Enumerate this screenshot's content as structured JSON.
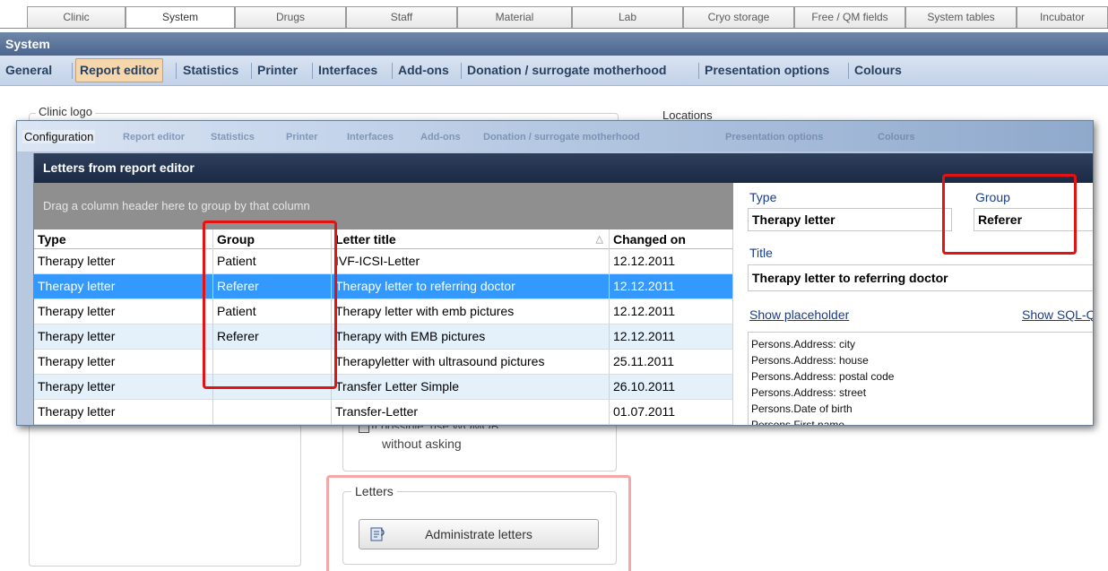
{
  "top_tabs": [
    {
      "label": "Clinic"
    },
    {
      "label": "System"
    },
    {
      "label": "Drugs"
    },
    {
      "label": "Staff"
    },
    {
      "label": "Material"
    },
    {
      "label": "Lab"
    },
    {
      "label": "Cryo storage"
    },
    {
      "label": "Free / QM fields"
    },
    {
      "label": "System tables"
    },
    {
      "label": "Incubator"
    }
  ],
  "system_bar": {
    "title": "System"
  },
  "sub_tabs": [
    {
      "label": "General"
    },
    {
      "label": "Report editor"
    },
    {
      "label": "Statistics"
    },
    {
      "label": "Printer"
    },
    {
      "label": "Interfaces"
    },
    {
      "label": "Add-ons"
    },
    {
      "label": "Donation / surrogate motherhood"
    },
    {
      "label": "Presentation options"
    },
    {
      "label": "Colours"
    }
  ],
  "background": {
    "clinic_logo_label": "Clinic logo",
    "locations_label": "Locations",
    "woman_text_fragment": "If possible, use WOMOB",
    "without_asking": "without asking",
    "letters_group_label": "Letters",
    "administrate_button": "Administrate letters"
  },
  "config_window": {
    "title": "Configuration",
    "ghost_tabs": [
      "Report editor",
      "Statistics",
      "Printer",
      "Interfaces",
      "Add-ons",
      "Donation / surrogate motherhood",
      "Presentation options",
      "Colours"
    ]
  },
  "letters_window": {
    "title": "Letters from report editor",
    "drag_hint": "Drag a column header here to group by that column",
    "columns": [
      "Type",
      "Group",
      "Letter title",
      "Changed on"
    ],
    "sort_indicator": "△",
    "rows": [
      {
        "type": "Therapy letter",
        "group": "Patient",
        "title": "IVF-ICSI-Letter",
        "changed": "12.12.2011"
      },
      {
        "type": "Therapy letter",
        "group": "Referer",
        "title": "Therapy letter to referring doctor",
        "changed": "12.12.2011"
      },
      {
        "type": "Therapy letter",
        "group": "Patient",
        "title": "Therapy letter with emb pictures",
        "changed": "12.12.2011"
      },
      {
        "type": "Therapy letter",
        "group": "Referer",
        "title": "Therapy with EMB pictures",
        "changed": "12.12.2011"
      },
      {
        "type": "Therapy letter",
        "group": "",
        "title": "Therapyletter with ultrasound pictures",
        "changed": "25.11.2011"
      },
      {
        "type": "Therapy letter",
        "group": "",
        "title": "Transfer Letter Simple",
        "changed": "26.10.2011"
      },
      {
        "type": "Therapy letter",
        "group": "",
        "title": "Transfer-Letter",
        "changed": "01.07.2011"
      }
    ],
    "selected_row": 1
  },
  "detail": {
    "type_label": "Type",
    "type_value": "Therapy letter",
    "group_label": "Group",
    "group_value": "Referer",
    "title_label": "Title",
    "title_value": "Therapy letter to referring doctor",
    "show_placeholder": "Show placeholder",
    "show_sql": "Show SQL-Q",
    "placeholders": [
      "Persons.Address: city",
      "Persons.Address: house",
      "Persons.Address: postal code",
      "Persons.Address: street",
      "Persons.Date of birth",
      "Persons.First name"
    ]
  },
  "colors": {
    "highlight_red": "#e31313",
    "selected_row": "#3399ff",
    "window_header": "#1b2a44",
    "system_bar": "#4c6690"
  }
}
